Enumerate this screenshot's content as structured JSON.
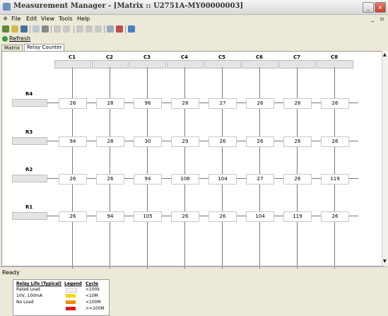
{
  "window": {
    "title": "Measurement Manager - [Matrix :: U2751A-MY00000003]"
  },
  "menu": [
    "File",
    "Edit",
    "View",
    "Tools",
    "Help"
  ],
  "toolbar": {
    "refresh_label": "Refresh"
  },
  "tabs": [
    {
      "label": "Matrix",
      "active": false
    },
    {
      "label": "Relay Counter",
      "active": true
    }
  ],
  "grid": {
    "columns": [
      "C1",
      "C2",
      "C3",
      "C4",
      "C5",
      "C6",
      "C7",
      "C8"
    ],
    "rows": [
      {
        "label": "R4",
        "values": [
          "26",
          "28",
          "96",
          "28",
          "27",
          "26",
          "26",
          "26"
        ]
      },
      {
        "label": "R3",
        "values": [
          "94",
          "28",
          "30",
          "29",
          "26",
          "26",
          "26",
          "26"
        ]
      },
      {
        "label": "R2",
        "values": [
          "26",
          "26",
          "94",
          "106",
          "104",
          "27",
          "26",
          "119"
        ]
      },
      {
        "label": "R1",
        "values": [
          "26",
          "94",
          "105",
          "26",
          "26",
          "104",
          "119",
          "26"
        ]
      }
    ]
  },
  "legend": {
    "headers": {
      "relay_life": "Relay Life (Typical)",
      "legend": "Legend",
      "cycle": "Cycle"
    },
    "loads": [
      "Rated Load",
      "10V, 100mA",
      "No Load"
    ],
    "items": [
      {
        "cycle": "<100k",
        "color": "#F0F0F0"
      },
      {
        "cycle": "<10M",
        "color": "#F5D800"
      },
      {
        "cycle": "<100M",
        "color": "#F08A00"
      },
      {
        "cycle": ">=100M",
        "color": "#E01A1A"
      }
    ]
  },
  "status": {
    "text": "Ready"
  }
}
